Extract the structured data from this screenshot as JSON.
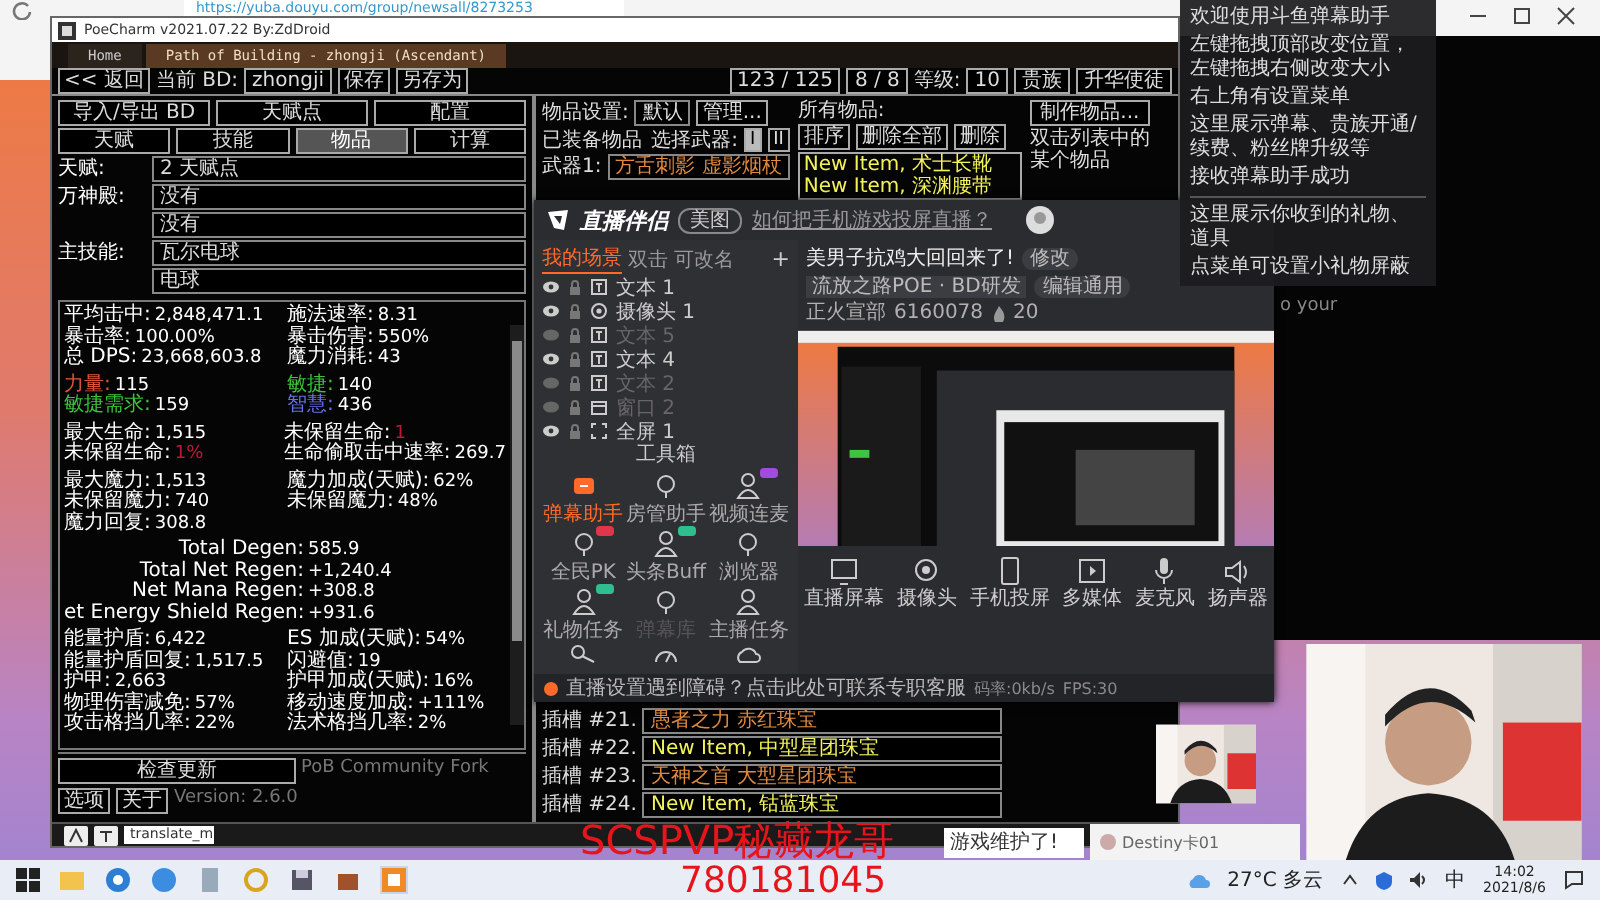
{
  "browser": {
    "url": "https://yuba.douyu.com/group/newsall/8273253"
  },
  "poecharm": {
    "title": "PoeCharm v2021.07.22 By:ZdDroid",
    "tabs": [
      {
        "label": "Home",
        "selected": false
      },
      {
        "label": "Path of Building - zhongji (Ascendant)",
        "selected": true
      }
    ],
    "toolbar": {
      "back": "<< 返回",
      "build_label": "当前 BD:",
      "build_name": "zhongji",
      "save": "保存",
      "save_as": "另存为",
      "points": "123 / 125",
      "ascend_points": "8 / 8",
      "level_label": "等级:",
      "level": "10",
      "class": "贵族",
      "ascendancy": "升华使徒"
    },
    "actions": [
      "导入/导出 BD",
      "天赋点",
      "配置"
    ],
    "sections": [
      {
        "label": "天赋",
        "selected": false
      },
      {
        "label": "技能",
        "selected": false
      },
      {
        "label": "物品",
        "selected": true
      },
      {
        "label": "计算",
        "selected": false
      }
    ],
    "selectors": [
      {
        "label": "天赋:",
        "values": [
          "2 天赋点"
        ]
      },
      {
        "label": "万神殿:",
        "values": [
          "没有",
          "没有"
        ]
      },
      {
        "label": "主技能:",
        "values": [
          "瓦尔电球",
          "电球"
        ]
      }
    ],
    "stat_groups": [
      [
        {
          "label": "平均击中:",
          "value": "2,848,471.1"
        },
        {
          "label": "施法速率:",
          "value": "8.31"
        },
        {
          "label": "暴击率:",
          "value": "100.00%"
        },
        {
          "label": "暴击伤害:",
          "value": "550%"
        },
        {
          "label": "总 DPS:",
          "value": "23,668,603.8"
        },
        {
          "label": "魔力消耗:",
          "value": "43"
        }
      ],
      [
        {
          "label": "力量:",
          "value": "115",
          "kind": "attr",
          "color": "#e0553a"
        },
        {
          "label": "敏捷:",
          "value": "140",
          "kind": "attr",
          "color": "#3ec43e"
        },
        {
          "label": "敏捷需求:",
          "value": "159",
          "kind": "attr",
          "color": "#3ec43e"
        },
        {
          "label": "智慧:",
          "value": "436",
          "kind": "attr",
          "color": "#6470e8"
        }
      ],
      [
        {
          "label": "最大生命:",
          "value": "1,515"
        },
        {
          "label": "未保留生命:",
          "value": "1",
          "kind": "warn",
          "color": "#c0183a"
        },
        {
          "label": "未保留生命:",
          "value": "1%",
          "kind": "warn",
          "color": "#c0183a"
        },
        {
          "label": "生命偷取击中速率:",
          "value": "269.7"
        }
      ],
      [
        {
          "label": "最大魔力:",
          "value": "1,513"
        },
        {
          "label": "魔力加成(天赋):",
          "value": "62%"
        },
        {
          "label": "未保留魔力:",
          "value": "740"
        },
        {
          "label": "未保留魔力:",
          "value": "48%"
        },
        {
          "label": "魔力回复:",
          "value": "308.8"
        }
      ],
      [
        {
          "label": "Total Degen:",
          "value": "585.9"
        },
        {
          "label": "Total Net Regen:",
          "value": "+1,240.4"
        },
        {
          "label": "Net Mana Regen:",
          "value": "+308.8"
        },
        {
          "label": "et Energy Shield Regen:",
          "value": "+931.6"
        }
      ],
      [
        {
          "label": "能量护盾:",
          "value": "6,422"
        },
        {
          "label": "ES 加成(天赋):",
          "value": "54%"
        },
        {
          "label": "能量护盾回复:",
          "value": "1,517.5"
        },
        {
          "label": "闪避值:",
          "value": "19"
        },
        {
          "label": "护甲:",
          "value": "2,663"
        },
        {
          "label": "护甲加成(天赋):",
          "value": "16%"
        },
        {
          "label": "物理伤害减免:",
          "value": "57%"
        },
        {
          "label": "移动速度加成:",
          "value": "+111%"
        },
        {
          "label": "攻击格挡几率:",
          "value": "22%"
        },
        {
          "label": "法术格挡几率:",
          "value": "2%"
        }
      ]
    ],
    "footer": {
      "buttons": [
        "检查更新",
        "选项",
        "关于"
      ],
      "fork": "PoB Community Fork",
      "version": "Version: 2.6.0"
    },
    "item_set": {
      "label": "物品设置:",
      "value": "默认",
      "manage": "管理..."
    },
    "equipped": {
      "title": "已装备物品",
      "select_label": "选择武器:",
      "weapon_sets": [
        {
          "label": "I",
          "selected": true
        },
        {
          "label": "II",
          "selected": false
        }
      ],
      "weapon_label": "武器1:",
      "weapon_value": "方舌刺影 虚影烟杖"
    },
    "all_items": {
      "title": "所有物品:",
      "buttons": [
        "排序",
        "删除全部",
        "删除"
      ],
      "items": [
        "New Item, 术士长靴",
        "New Item, 深渊腰带"
      ]
    },
    "craft": "制作物品...",
    "hint": "双击列表中的某个物品",
    "sockets": [
      {
        "label": "插槽 #21.",
        "value": "愚者之力 赤红珠宝",
        "kind": "unique"
      },
      {
        "label": "插槽 #22.",
        "value": "New Item, 中型星团珠宝",
        "kind": "rare"
      },
      {
        "label": "插槽 #23.",
        "value": "天神之首 大型星团珠宝",
        "kind": "unique"
      },
      {
        "label": "插槽 #24.",
        "value": "New Item, 钴蓝珠宝",
        "kind": "rare"
      }
    ],
    "input": "translate_m"
  },
  "streamer": {
    "logo": "直播伴侣",
    "tag": "美图",
    "link": "如何把手机游戏投屏直播？",
    "scene_tabs": [
      {
        "label": "我的场景",
        "selected": true
      },
      {
        "label": "双击",
        "selected": false
      },
      {
        "label": "可改名",
        "selected": false
      }
    ],
    "add": "+",
    "layers": [
      {
        "name": "文本 1",
        "visible": true,
        "kind": "text"
      },
      {
        "name": "摄像头 1",
        "visible": true,
        "kind": "camera"
      },
      {
        "name": "文本 5",
        "visible": false,
        "kind": "text"
      },
      {
        "name": "文本 4",
        "visible": true,
        "kind": "text"
      },
      {
        "name": "文本 2",
        "visible": false,
        "kind": "text"
      },
      {
        "name": "窗口 2",
        "visible": false,
        "kind": "window"
      },
      {
        "name": "全屏 1",
        "visible": true,
        "kind": "screen"
      }
    ],
    "toolbox": "工具箱",
    "tools": [
      {
        "label": "弹幕助手",
        "selected": true,
        "disabled": false
      },
      {
        "label": "房管助手",
        "selected": false,
        "disabled": false
      },
      {
        "label": "视频连麦",
        "selected": false,
        "disabled": false,
        "color": "#a24be0"
      },
      {
        "label": "全民PK",
        "selected": false,
        "disabled": false,
        "color": "#e0364b"
      },
      {
        "label": "头条Buff",
        "selected": false,
        "disabled": false,
        "color": "#2fbf8f"
      },
      {
        "label": "浏览器",
        "selected": false,
        "disabled": false
      },
      {
        "label": "礼物任务",
        "selected": false,
        "disabled": false,
        "color": "#2fbf8f"
      },
      {
        "label": "弹幕库",
        "selected": false,
        "disabled": true
      },
      {
        "label": "主播任务",
        "selected": false,
        "disabled": false
      }
    ],
    "stream_title": "美男子抗鸡大回回来了!",
    "edit": "修改",
    "category": "流放之路POE · BD研发",
    "category_button": "编辑通用",
    "room_label": "正火宣部",
    "room_id": "6160078",
    "viewers": "20",
    "controls": [
      "直播屏幕",
      "摄像头",
      "手机投屏",
      "多媒体",
      "麦克风",
      "扬声器"
    ],
    "notice": "直播设置遇到障碍？点击此处可联系专职客服",
    "rate": "码率:0kb/s",
    "fps": "FPS:30"
  },
  "danmu_panel": {
    "groups": [
      [
        "欢迎使用斗鱼弹幕助手",
        "左键拖拽顶部改变位置，左键拖拽右侧改变大小",
        "右上角有设置菜单",
        "这里展示弹幕、贵族开通/续费、粉丝牌升级等",
        "接收弹幕助手成功"
      ],
      [
        "这里展示你收到的礼物、道具",
        "点菜单可设置小礼物屏蔽"
      ]
    ]
  },
  "overlay": {
    "name": "SCSPVP秘藏龙哥",
    "number": "780181045"
  },
  "page": {
    "post": "游戏维护了!",
    "user": "Destiny卡01",
    "fragment": "o your"
  },
  "taskbar": {
    "weather": "27°C 多云",
    "ime": "中",
    "time": "14:02",
    "date": "2021/8/6"
  }
}
